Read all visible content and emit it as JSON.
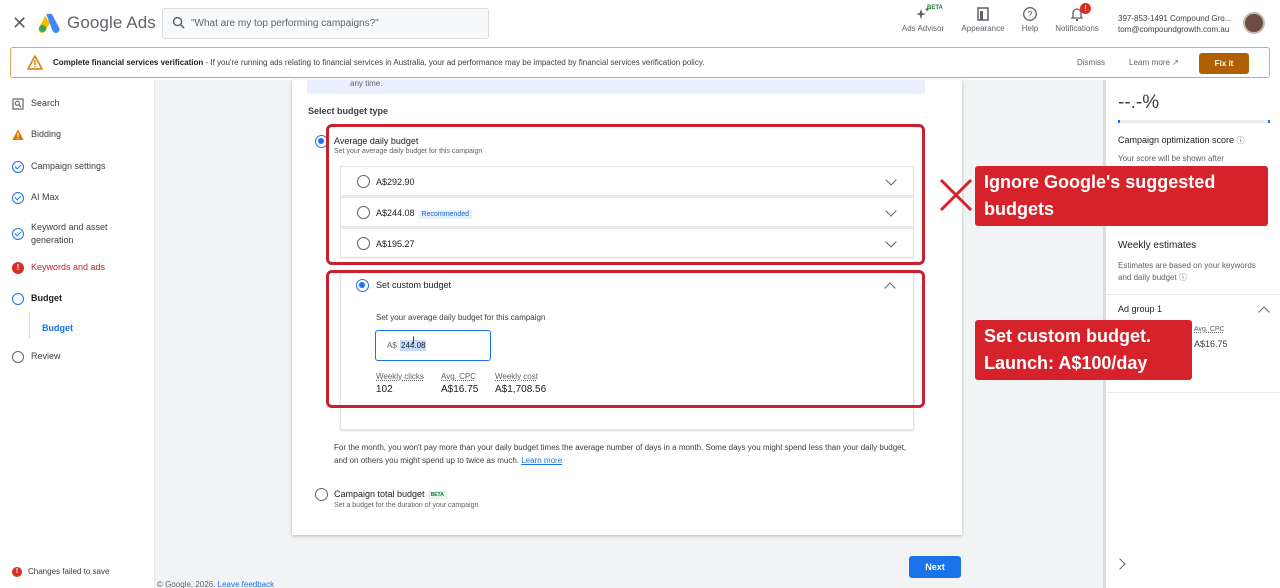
{
  "header": {
    "close_icon": "close-icon",
    "brand": "Google Ads",
    "search_placeholder": "\"What are my top performing campaigns?\"",
    "tools": [
      {
        "label": "Ads Advisor",
        "badge": "BETA"
      },
      {
        "label": "Appearance"
      },
      {
        "label": "Help"
      },
      {
        "label": "Notifications",
        "badge": "!"
      }
    ],
    "account_id": "397-853-1491 Compound Gro...",
    "account_email": "tom@compoundgrowth.com.au"
  },
  "banner": {
    "title": "Complete financial services verification",
    "message": " - If you're running ads relating to financial services in Australia, your ad performance may be impacted by financial services verification policy.",
    "dismiss": "Dismiss",
    "learn_more": "Learn more",
    "fix": "Fix it"
  },
  "sidenav": {
    "items": [
      {
        "label": "Search",
        "status": "search"
      },
      {
        "label": "Bidding",
        "status": "warning"
      },
      {
        "label": "Campaign settings",
        "status": "done"
      },
      {
        "label": "AI Max",
        "status": "done"
      },
      {
        "label": "Keyword and asset generation",
        "status": "done"
      },
      {
        "label": "Keywords and ads",
        "status": "error"
      },
      {
        "label": "Budget",
        "status": "current"
      },
      {
        "label": "Budget",
        "status": "sub"
      },
      {
        "label": "Review",
        "status": "pending"
      }
    ],
    "footer_status": "Changes failed to save"
  },
  "budget": {
    "top_fragment": "any time.",
    "select_type": "Select budget type",
    "avg_daily_title": "Average daily budget",
    "avg_daily_desc": "Set your average daily budget for this campaign",
    "options": [
      {
        "amount": "A$292.90"
      },
      {
        "amount": "A$244.08",
        "badge": "Recommended"
      },
      {
        "amount": "A$195.27"
      }
    ],
    "custom_title": "Set custom budget",
    "custom_desc": "Set your average daily budget for this campaign",
    "currency_prefix": "A$",
    "input_value": "244.08",
    "metrics": [
      {
        "label": "Weekly clicks",
        "value": "102"
      },
      {
        "label": "Avg. CPC",
        "value": "A$16.75"
      },
      {
        "label": "Weekly cost",
        "value": "A$1,708.56"
      }
    ],
    "month_note": "For the month, you won't pay more than your daily budget times the average number of days in a month. Some days you might spend less than your daily budget, and on others you might spend up to twice as much.",
    "month_note_link": "Learn more",
    "total_title": "Campaign total budget",
    "total_badge": "BETA",
    "total_desc": "Set a budget for the duration of your campaign",
    "next": "Next"
  },
  "footer": {
    "copyright": "© Google, 2026.",
    "feedback": "Leave feedback"
  },
  "right_panel": {
    "score": "--.-%",
    "score_title": "Campaign optimization score",
    "score_desc": "Your score will be shown after",
    "weekly_title": "Weekly estimates",
    "weekly_desc": "Estimates are based on your keywords and daily budget",
    "adgroup": "Ad group 1",
    "adgroup_cpc_label": "Avg. CPC",
    "adgroup_cpc_value": "A$16.75"
  },
  "annotations": {
    "callout_1": "Ignore Google's suggested budgets",
    "callout_2": "Set custom budget. Launch: A$100/day",
    "accent": "#d6232b"
  }
}
